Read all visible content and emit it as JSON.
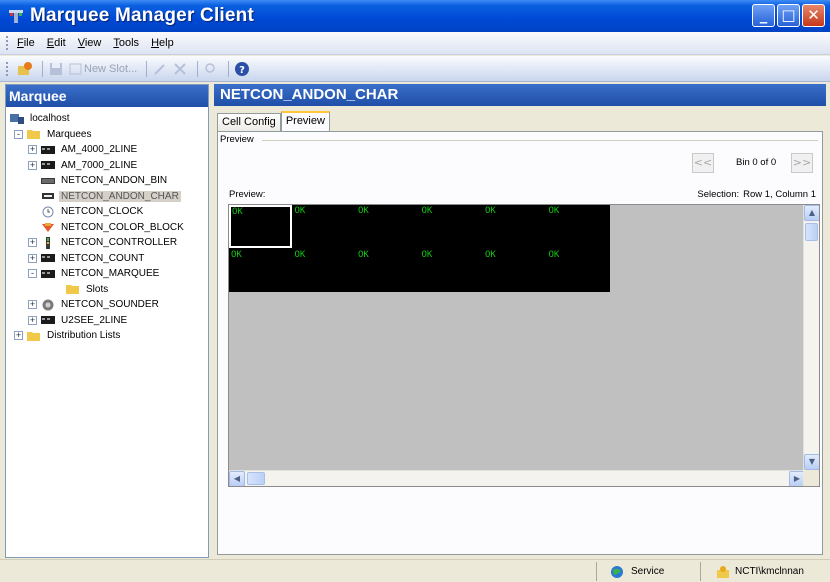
{
  "window": {
    "title": "Marquee Manager Client",
    "controls": {
      "minimize": "_",
      "maximize": "□",
      "close": "✕"
    }
  },
  "menu": [
    {
      "label": "File",
      "key": "F",
      "rest": "ile"
    },
    {
      "label": "Edit",
      "key": "E",
      "rest": "dit"
    },
    {
      "label": "View",
      "key": "V",
      "rest": "iew"
    },
    {
      "label": "Tools",
      "key": "T",
      "rest": "ools"
    },
    {
      "label": "Help",
      "key": "H",
      "rest": "elp"
    }
  ],
  "toolbar": {
    "new_slot_label": "New Slot...",
    "help_icon": "help-icon"
  },
  "left_pane": {
    "header": "Marquee",
    "tree": {
      "root": "localhost",
      "marquees_label": "Marquees",
      "items": [
        {
          "label": "AM_4000_2LINE",
          "expander": "+",
          "icon": "led-sign-icon"
        },
        {
          "label": "AM_7000_2LINE",
          "expander": "+",
          "icon": "led-sign-icon"
        },
        {
          "label": "NETCON_ANDON_BIN",
          "expander": "",
          "icon": "bin-icon"
        },
        {
          "label": "NETCON_ANDON_CHAR",
          "expander": "",
          "icon": "char-icon",
          "selected": true
        },
        {
          "label": "NETCON_CLOCK",
          "expander": "",
          "icon": "clock-icon"
        },
        {
          "label": "NETCON_COLOR_BLOCK",
          "expander": "",
          "icon": "color-block-icon"
        },
        {
          "label": "NETCON_CONTROLLER",
          "expander": "+",
          "icon": "controller-icon"
        },
        {
          "label": "NETCON_COUNT",
          "expander": "+",
          "icon": "led-sign-icon"
        },
        {
          "label": "NETCON_MARQUEE",
          "expander": "-",
          "icon": "led-sign-icon"
        },
        {
          "label": "Slots",
          "expander": "",
          "icon": "folder-icon",
          "indent": 1
        },
        {
          "label": "NETCON_SOUNDER",
          "expander": "+",
          "icon": "sounder-icon"
        },
        {
          "label": "U2SEE_2LINE",
          "expander": "+",
          "icon": "led-sign-icon"
        }
      ],
      "distribution_label": "Distribution Lists"
    }
  },
  "right_pane": {
    "header": "NETCON_ANDON_CHAR",
    "tabs": [
      {
        "label": "Cell Config",
        "active": false
      },
      {
        "label": "Preview",
        "active": true
      }
    ],
    "group_label": "Preview",
    "bin_prev": "<<",
    "bin_next": ">>",
    "bin_text": "Bin 0 of 0",
    "preview_label": "Preview:",
    "selection_label": "Selection:",
    "selection_value": "Row 1, Column 1",
    "grid": {
      "rows": 2,
      "columns": 6,
      "cell_text": "OK",
      "selected_row": 1,
      "selected_column": 1,
      "background": "#000000",
      "text_color": "#12c212"
    }
  },
  "status": {
    "service": "Service",
    "user": "NCTI\\kmclnnan"
  }
}
